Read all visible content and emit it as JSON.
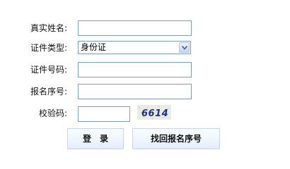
{
  "form": {
    "real_name_label": "真实姓名:",
    "id_type_label": "证件类型:",
    "id_type_selected": "身份证",
    "id_number_label": "证件号码:",
    "reg_number_label": "报名序号:",
    "captcha_label": "校验码:",
    "captcha_text": "6614",
    "login_button": "登录",
    "recover_button": "找回报名序号"
  }
}
